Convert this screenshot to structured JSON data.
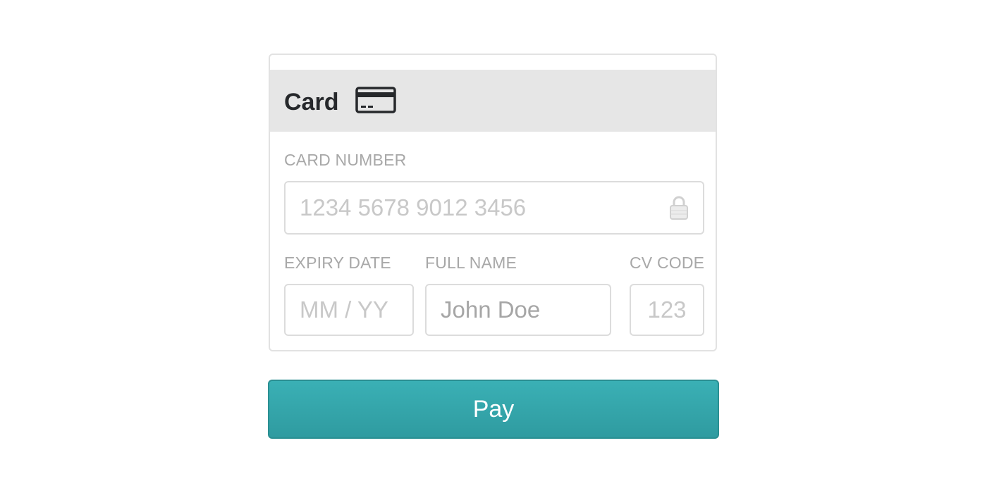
{
  "card_section": {
    "title": "Card",
    "title_icon": "credit-card-icon"
  },
  "fields": {
    "card_number": {
      "label": "CARD NUMBER",
      "value": "",
      "placeholder": "1234 5678 9012 3456",
      "icon": "lock-icon"
    },
    "expiry": {
      "label": "EXPIRY DATE",
      "value": "",
      "placeholder": "MM / YY"
    },
    "full_name": {
      "label": "FULL NAME",
      "value": "",
      "placeholder": "John Doe"
    },
    "cv_code": {
      "label": "CV CODE",
      "value": "",
      "placeholder": "123"
    }
  },
  "pay_button": {
    "label": "Pay"
  },
  "colors": {
    "accent": "#36a9ae",
    "header_bg": "#e6e6e6",
    "label_text": "#a8a8a8",
    "title_text": "#26282b"
  }
}
